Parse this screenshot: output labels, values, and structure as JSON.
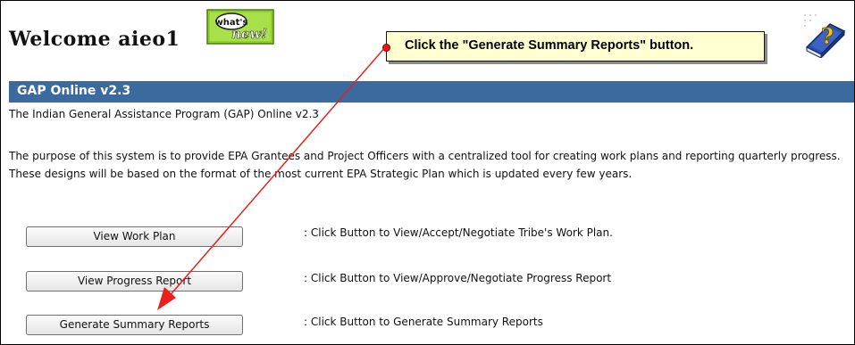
{
  "header": {
    "welcome_text": "Welcome aieo1",
    "whats_new_badge": "what's new!"
  },
  "callout": {
    "text": "Click the \"Generate Summary Reports\" button."
  },
  "app": {
    "title": "GAP Online v2.3",
    "subtitle": "The Indian General Assistance Program (GAP) Online v2.3",
    "purpose": "The purpose of this system is to provide EPA Grantees and Project Officers with a centralized tool for creating work plans and reporting quarterly progress. These designs will be based on the format of the most current EPA Strategic Plan which is updated every few years."
  },
  "actions": [
    {
      "label": "View Work Plan",
      "description": ": Click Button to View/Accept/Negotiate Tribe's Work Plan."
    },
    {
      "label": "View Progress Report",
      "description": ": Click Button to View/Approve/Negotiate Progress Report"
    },
    {
      "label": "Generate Summary Reports",
      "description": ": Click Button to Generate Summary Reports"
    }
  ],
  "colors": {
    "title_bar": "#3a6a9e",
    "callout_bg": "#ffffd2",
    "arrow": "#e8221b"
  },
  "icons": [
    "whats-new-badge-icon",
    "help-book-icon"
  ]
}
